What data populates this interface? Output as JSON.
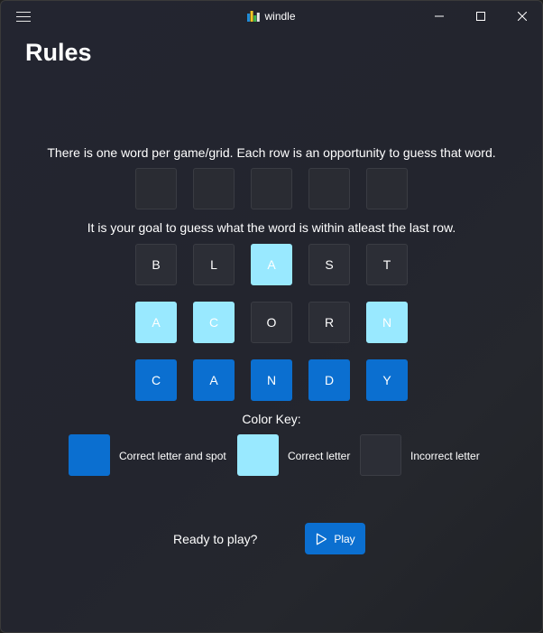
{
  "titlebar": {
    "app_name": "windle",
    "icons": [
      "menu-icon",
      "app-logo-icon",
      "minimize-icon",
      "maximize-icon",
      "close-icon"
    ]
  },
  "page": {
    "title": "Rules"
  },
  "rules": {
    "line1": "There is one word per game/grid. Each row is an opportunity to guess that word.",
    "line2": "It is your goal to guess what the word is within atleast the last row."
  },
  "rows": [
    {
      "tiles": [
        {
          "letter": "",
          "status": "empty"
        },
        {
          "letter": "",
          "status": "empty"
        },
        {
          "letter": "",
          "status": "empty"
        },
        {
          "letter": "",
          "status": "empty"
        },
        {
          "letter": "",
          "status": "empty"
        }
      ]
    },
    {
      "tiles": [
        {
          "letter": "B",
          "status": "absent"
        },
        {
          "letter": "L",
          "status": "absent"
        },
        {
          "letter": "A",
          "status": "present"
        },
        {
          "letter": "S",
          "status": "absent"
        },
        {
          "letter": "T",
          "status": "absent"
        }
      ]
    },
    {
      "tiles": [
        {
          "letter": "A",
          "status": "present"
        },
        {
          "letter": "C",
          "status": "present"
        },
        {
          "letter": "O",
          "status": "absent"
        },
        {
          "letter": "R",
          "status": "absent"
        },
        {
          "letter": "N",
          "status": "present"
        }
      ]
    },
    {
      "tiles": [
        {
          "letter": "C",
          "status": "correct"
        },
        {
          "letter": "A",
          "status": "correct"
        },
        {
          "letter": "N",
          "status": "correct"
        },
        {
          "letter": "D",
          "status": "correct"
        },
        {
          "letter": "Y",
          "status": "correct"
        }
      ]
    }
  ],
  "color_key": {
    "title": "Color Key:",
    "items": [
      {
        "label": "Correct letter and spot",
        "color": "#0b6fd0"
      },
      {
        "label": "Correct letter",
        "color": "#99e9ff"
      },
      {
        "label": "Incorrect letter",
        "color": "#2c2e36"
      }
    ]
  },
  "footer": {
    "prompt": "Ready to play?",
    "play_label": "Play",
    "play_icon": "play-icon"
  },
  "colors": {
    "accent": "#0b6fd0",
    "present": "#99e9ff",
    "absent": "#2c2e36",
    "background": "#23252e"
  }
}
